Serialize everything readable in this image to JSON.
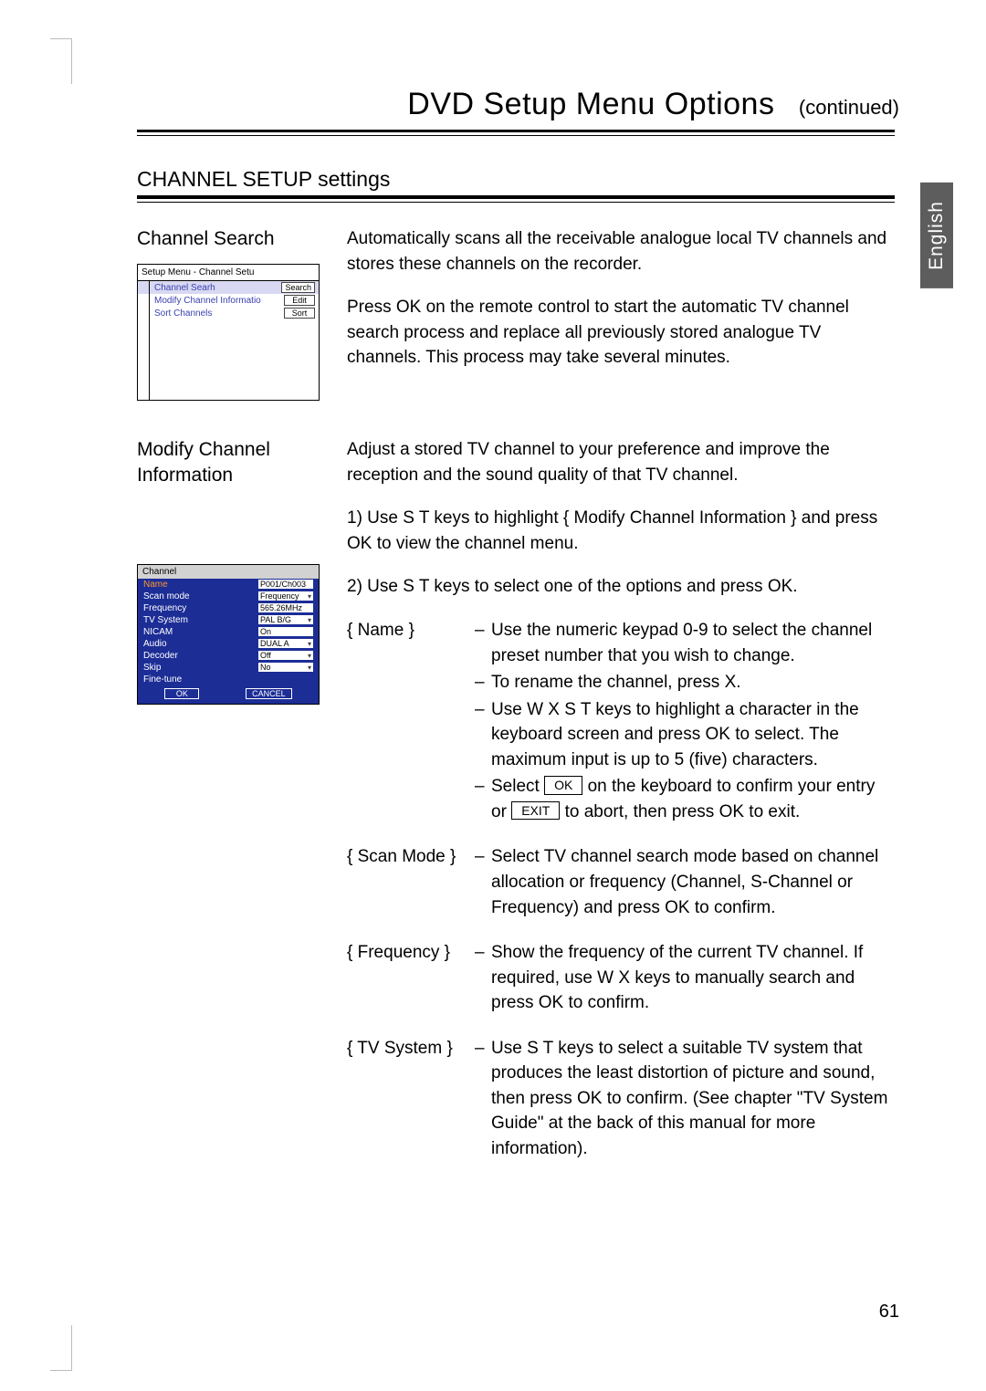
{
  "lang_tab": "English",
  "title": {
    "main": "DVD Setup Menu Options",
    "sub": "(continued)"
  },
  "section_head": "CHANNEL SETUP settings",
  "cs": {
    "head": "Channel Search",
    "p1": "Automatically scans all the receivable analogue local TV channels and stores these channels on the recorder.",
    "p2": "Press OK on the remote control to start the automatic TV channel search process and replace all previously stored analogue TV channels. This process may take several minutes.",
    "menu": {
      "title": "Setup Menu - Channel Setu",
      "rows": [
        {
          "label": "Channel Searh",
          "btn": "Search"
        },
        {
          "label": "Modify Channel Informatio",
          "btn": "Edit"
        },
        {
          "label": "Sort Channels",
          "btn": "Sort"
        }
      ]
    }
  },
  "mc": {
    "head": "Modify Channel Information",
    "p1": "Adjust a stored TV channel to your preference and improve the reception and the sound quality of that TV channel.",
    "step1a": "1)  Use  S T keys to highlight { ",
    "step1b": "Modify Channel  Information   ",
    "step1c": "} and press OK to view the channel menu.",
    "step2": "2)  Use  S T keys to select one of the options and press OK.",
    "menu": {
      "title": "Channel",
      "rows": [
        {
          "label": "Name",
          "val": "P001/Ch003",
          "dd": false,
          "hi": true
        },
        {
          "label": "Scan mode",
          "val": "Frequency",
          "dd": true
        },
        {
          "label": "Frequency",
          "val": "565.26MHz",
          "dd": false
        },
        {
          "label": "TV System",
          "val": "PAL B/G",
          "dd": true
        },
        {
          "label": "NICAM",
          "val": "On",
          "dd": false
        },
        {
          "label": "Audio",
          "val": "DUAL A",
          "dd": true
        },
        {
          "label": "Decoder",
          "val": "Off",
          "dd": true
        },
        {
          "label": "Skip",
          "val": "No",
          "dd": true
        },
        {
          "label": "Fine-tune",
          "val": "",
          "dd": false
        }
      ],
      "ok": "OK",
      "cancel": "CANCEL"
    },
    "opts": {
      "name": {
        "key": "{ Name }",
        "l1": "Use the numeric keypad 0-9 to select the channel preset number that you wish to change.",
        "l2": "To rename the channel, press  X.",
        "l3": "Use  W X  S T keys to highlight a character in the keyboard screen and press OK to select. The maximum input is up to 5 (five) characters.",
        "l4a": "Select ",
        "l4ok": "OK",
        "l4b": " on the keyboard to confirm your entry or ",
        "l4exit": "EXIT",
        "l4c": " to abort, then press OK to exit."
      },
      "scan": {
        "key": "{ Scan Mode }",
        "l1": "Select TV channel search mode based on channel allocation or frequency (Channel, S-Channel or Frequency) and press OK to confirm."
      },
      "freq": {
        "key": "{ Frequency }",
        "l1": "Show the frequency of the current TV channel. If required, use  W X keys to manually search and press OK to confirm."
      },
      "tvsys": {
        "key": "{ TV System }",
        "l1": "Use  S T keys to select a suitable TV system that produces the least distortion of picture and sound, then press OK to confirm. (See chapter \"TV System Guide\" at the back of this manual for more information)."
      }
    }
  },
  "page_number": "61"
}
